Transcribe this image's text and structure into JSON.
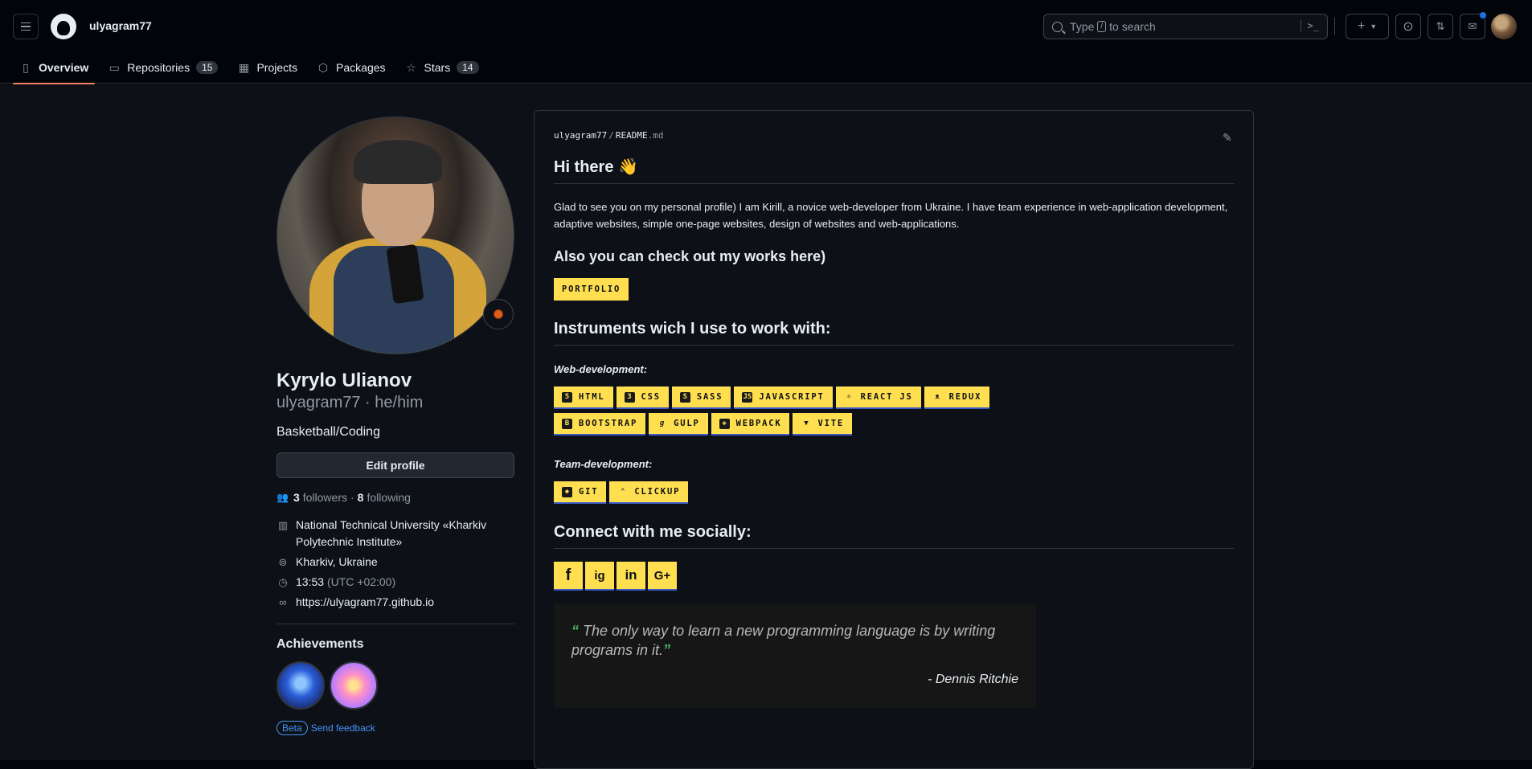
{
  "header": {
    "context_name": "ulyagram77",
    "search_placeholder_pre": "Type",
    "search_key": "/",
    "search_placeholder_post": "to search",
    "command_symbol": ">_"
  },
  "tabs": [
    {
      "label": "Overview",
      "count": null
    },
    {
      "label": "Repositories",
      "count": "15"
    },
    {
      "label": "Projects",
      "count": null
    },
    {
      "label": "Packages",
      "count": null
    },
    {
      "label": "Stars",
      "count": "14"
    }
  ],
  "profile": {
    "full_name": "Kyrylo Ulianov",
    "login_line": "ulyagram77 · he/him",
    "bio": "Basketball/Coding",
    "edit_label": "Edit profile",
    "followers_count": "3",
    "followers_label": "followers",
    "dot": "·",
    "following_count": "8",
    "following_label": "following",
    "organization": "National Technical University «Kharkiv Polytechnic Institute»",
    "location": "Kharkiv, Ukraine",
    "local_time": "13:53",
    "timezone": "(UTC +02:00)",
    "website": "https://ulyagram77.github.io",
    "achievements_title": "Achievements",
    "beta_label": "Beta",
    "feedback_label": "Send feedback"
  },
  "readme": {
    "path_user": "ulyagram77",
    "path_sep": "/",
    "path_file": "README",
    "path_ext": ".md",
    "greeting": "Hi there 👋",
    "intro": "Glad to see you on my personal profile) I am Kirill, a novice web-developer from Ukraine. I have team experience in web-application development, adaptive websites, simple one-page websites, design of websites and web-applications.",
    "works_heading": "Also you can check out my works here)",
    "portfolio_label": "PORTFOLIO",
    "instruments_heading": "Instruments wich I use to work with:",
    "web_dev_label": "Web-development:",
    "web_dev_chips": [
      "HTML",
      "CSS",
      "SASS",
      "JAVASCRIPT",
      "REACT JS",
      "REDUX",
      "BOOTSTRAP",
      "GULP",
      "WEBPACK",
      "VITE"
    ],
    "team_dev_label": "Team-development:",
    "team_dev_chips": [
      "GIT",
      "CLICKUP"
    ],
    "social_heading": "Connect with me socially:",
    "social_icons": [
      "f",
      "ig",
      "in",
      "G+"
    ],
    "quote_text": "The only way to learn a new programming language is by writing programs in it.",
    "quote_author": "- Dennis Ritchie"
  },
  "colors": {
    "badge_yellow": "#ffdf4f",
    "accent_underline": "#f78166",
    "link_blue": "#4493f8"
  }
}
